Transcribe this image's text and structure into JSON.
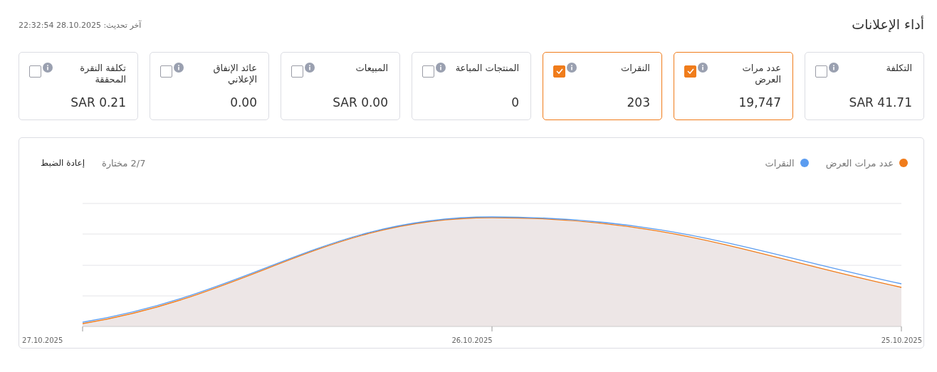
{
  "header": {
    "title": "أداء الإعلانات",
    "last_updated": "آخر تحديث: 28.10.2025 22:32:54"
  },
  "metrics": [
    {
      "label": "التكلفة",
      "value": "SAR 41.71",
      "checked": false
    },
    {
      "label": "عدد مرات العرض",
      "value": "19,747",
      "checked": true
    },
    {
      "label": "النقرات",
      "value": "203",
      "checked": true
    },
    {
      "label": "المنتجات المباعة",
      "value": "0",
      "checked": false
    },
    {
      "label": "المبيعات",
      "value": "SAR 0.00",
      "checked": false
    },
    {
      "label": "عائد الإنفاق الإعلاني",
      "value": "0.00",
      "checked": false
    },
    {
      "label": "تكلفة النقرة المحققة",
      "value": "SAR 0.21",
      "checked": false
    }
  ],
  "chart": {
    "legend": [
      {
        "label": "عدد مرات العرض",
        "color": "#f07c1b"
      },
      {
        "label": "النقرات",
        "color": "#5b9cf0"
      }
    ],
    "selected_count": "2/7 مختارة",
    "reset_button": "إعادة الضبط",
    "x_labels": [
      "25.10.2025",
      "26.10.2025",
      "27.10.2025"
    ]
  }
}
